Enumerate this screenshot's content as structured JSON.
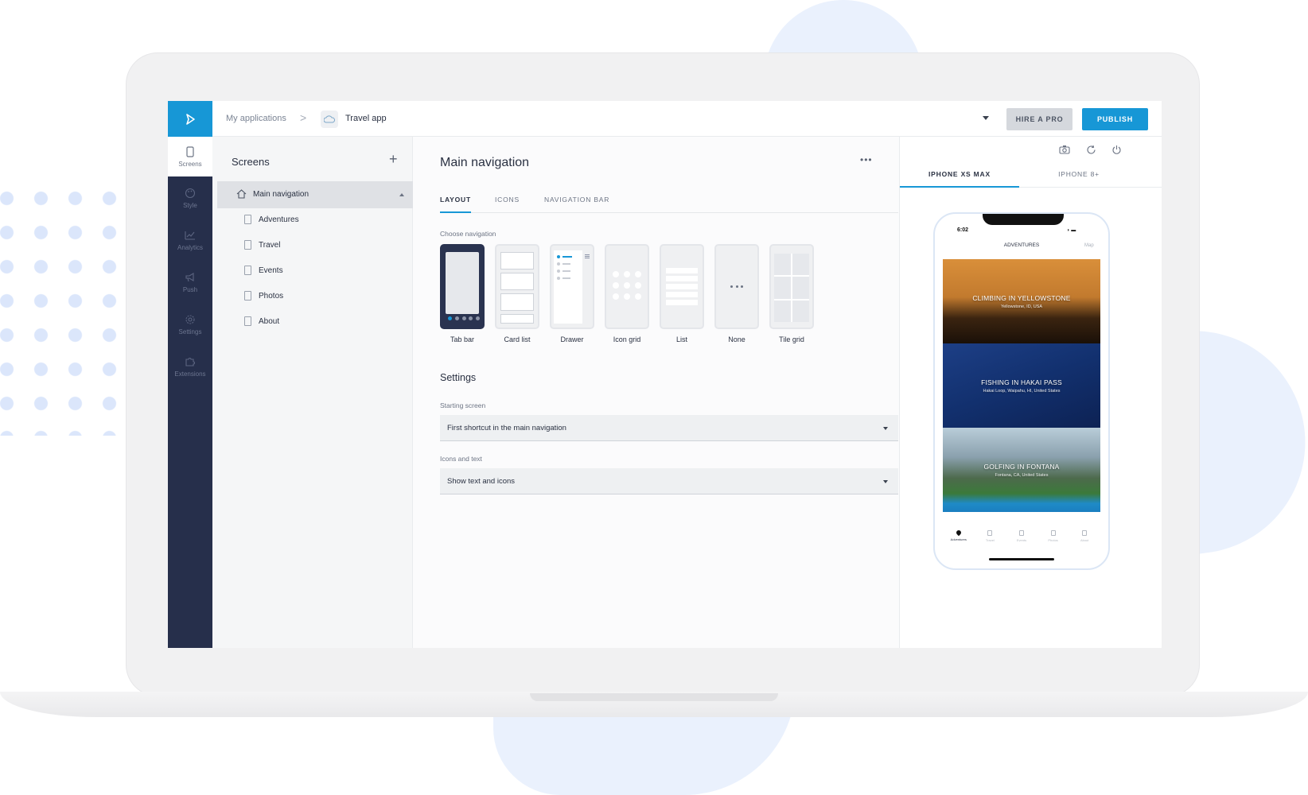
{
  "topbar": {
    "breadcrumb_root": "My applications",
    "breadcrumb_sep": ">",
    "app_name": "Travel app",
    "hire_label": "HIRE A PRO",
    "publish_label": "PUBLISH"
  },
  "rail": {
    "items": [
      {
        "label": "Screens",
        "icon": "phone-icon"
      },
      {
        "label": "Style",
        "icon": "palette-icon"
      },
      {
        "label": "Analytics",
        "icon": "chart-icon"
      },
      {
        "label": "Push",
        "icon": "megaphone-icon"
      },
      {
        "label": "Settings",
        "icon": "gear-icon"
      },
      {
        "label": "Extensions",
        "icon": "puzzle-icon"
      }
    ]
  },
  "screens": {
    "title": "Screens",
    "add_label": "+",
    "main_nav_label": "Main navigation",
    "items": [
      "Adventures",
      "Travel",
      "Events",
      "Photos",
      "About"
    ]
  },
  "main": {
    "title": "Main navigation",
    "more_label": "•••",
    "tabs": [
      "LAYOUT",
      "ICONS",
      "NAVIGATION BAR"
    ],
    "choose_label": "Choose navigation",
    "options": [
      "Tab bar",
      "Card list",
      "Drawer",
      "Icon grid",
      "List",
      "None",
      "Tile grid"
    ],
    "settings_title": "Settings",
    "starting_label": "Starting screen",
    "starting_value": "First shortcut in the main navigation",
    "icons_label": "Icons and text",
    "icons_value": "Show text and icons"
  },
  "preview": {
    "device_tabs": [
      "IPHONE XS MAX",
      "IPHONE 8+"
    ],
    "phone": {
      "time": "6:02",
      "header": "ADVENTURES",
      "map_label": "Map",
      "cards": [
        {
          "title": "CLIMBING IN YELLOWSTONE",
          "subtitle": "Yellowstone, ID, USA"
        },
        {
          "title": "FISHING IN HAKAI PASS",
          "subtitle": "Hakai Loop, Waipahu, HI, United States"
        },
        {
          "title": "GOLFING IN FONTANA",
          "subtitle": "Fontana, CA, United States"
        }
      ],
      "tabs": [
        "Adventures",
        "Travel",
        "Events",
        "Photos",
        "About"
      ]
    }
  },
  "colors": {
    "accent": "#1797d6",
    "rail": "#262f4b"
  }
}
